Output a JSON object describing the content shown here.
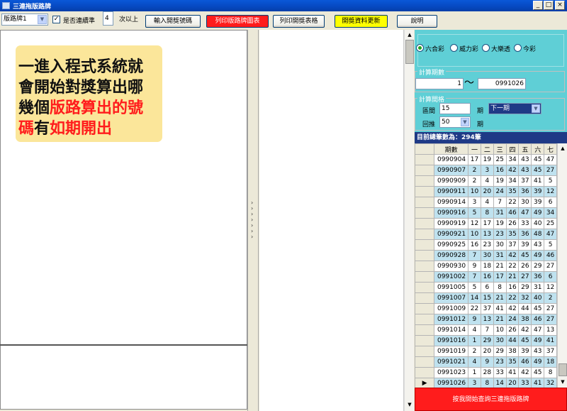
{
  "window": {
    "title": "三連拖版路牌",
    "controls": {
      "minimize": "_",
      "maximize": "□",
      "close": "×"
    }
  },
  "toolbar": {
    "mode_select": "版路牌1",
    "consecutive_checked": true,
    "consecutive_label": "是否連續準",
    "count_value": "4",
    "count_suffix": "次以上",
    "btn_input": "輸入開獎號碼",
    "btn_print_chart": "列印版路牌圖表",
    "btn_print_table": "列印開獎表格",
    "btn_update": "開獎資料更新",
    "btn_help": "說明"
  },
  "note": {
    "line1": "一進入程式系統就",
    "line2": "會開始對獎算出哪",
    "line3_a": "幾個",
    "line3_b": "版路算出的號",
    "line4_a": "碼",
    "line4_b": "有",
    "line4_c": "如期開出"
  },
  "lottery": {
    "options": [
      "六合彩",
      "威力彩",
      "大樂透",
      "今彩"
    ],
    "selected": "六合彩"
  },
  "period_range": {
    "label": "計算期數",
    "from": "1",
    "tilde": "〜",
    "to": "0991026"
  },
  "interval": {
    "label": "計算間格",
    "gap_label": "區間",
    "gap_value": "15",
    "gap_unit": "期",
    "gap_select": "下一期",
    "back_label": "回推",
    "back_value": "50",
    "back_unit": "期"
  },
  "total_count": "目前總筆數為：294筆",
  "grid": {
    "headers": [
      "期數",
      "一",
      "二",
      "三",
      "四",
      "五",
      "六",
      "七"
    ],
    "rows": [
      [
        "0990904",
        "17",
        "19",
        "25",
        "34",
        "43",
        "45",
        "47"
      ],
      [
        "0990907",
        "2",
        "3",
        "16",
        "42",
        "43",
        "45",
        "27"
      ],
      [
        "0990909",
        "2",
        "4",
        "19",
        "34",
        "37",
        "41",
        "5"
      ],
      [
        "0990911",
        "10",
        "20",
        "24",
        "35",
        "36",
        "39",
        "12"
      ],
      [
        "0990914",
        "3",
        "4",
        "7",
        "22",
        "30",
        "39",
        "6"
      ],
      [
        "0990916",
        "5",
        "8",
        "31",
        "46",
        "47",
        "49",
        "34"
      ],
      [
        "0990919",
        "12",
        "17",
        "19",
        "26",
        "33",
        "40",
        "25"
      ],
      [
        "0990921",
        "10",
        "13",
        "23",
        "35",
        "36",
        "48",
        "47"
      ],
      [
        "0990925",
        "16",
        "23",
        "30",
        "37",
        "39",
        "43",
        "5"
      ],
      [
        "0990928",
        "7",
        "30",
        "31",
        "42",
        "45",
        "49",
        "46"
      ],
      [
        "0990930",
        "9",
        "18",
        "21",
        "22",
        "26",
        "29",
        "27"
      ],
      [
        "0991002",
        "7",
        "16",
        "17",
        "21",
        "27",
        "36",
        "6"
      ],
      [
        "0991005",
        "5",
        "6",
        "8",
        "16",
        "29",
        "31",
        "12"
      ],
      [
        "0991007",
        "14",
        "15",
        "21",
        "22",
        "32",
        "40",
        "2"
      ],
      [
        "0991009",
        "22",
        "37",
        "41",
        "42",
        "44",
        "45",
        "27"
      ],
      [
        "0991012",
        "9",
        "13",
        "21",
        "24",
        "38",
        "46",
        "27"
      ],
      [
        "0991014",
        "4",
        "7",
        "10",
        "26",
        "42",
        "47",
        "13"
      ],
      [
        "0991016",
        "1",
        "29",
        "30",
        "44",
        "45",
        "49",
        "41"
      ],
      [
        "0991019",
        "2",
        "20",
        "29",
        "38",
        "39",
        "43",
        "37"
      ],
      [
        "0991021",
        "4",
        "9",
        "23",
        "35",
        "46",
        "49",
        "18"
      ],
      [
        "0991023",
        "1",
        "28",
        "33",
        "41",
        "42",
        "45",
        "8"
      ],
      [
        "0991026",
        "3",
        "8",
        "14",
        "20",
        "33",
        "41",
        "32"
      ]
    ]
  },
  "query_button": "按我開始查詢三連拖版路牌"
}
